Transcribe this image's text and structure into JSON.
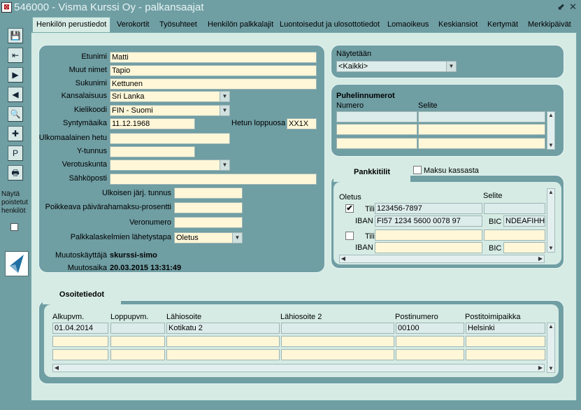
{
  "window": {
    "title": "546000 - Visma Kurssi Oy - palkansaajat",
    "app_icon": "app-icon",
    "minimize": "⬋",
    "close": "✕"
  },
  "toolbar": {
    "buttons": [
      {
        "icon": "save-icon",
        "glyph": "💾"
      },
      {
        "icon": "first-record-icon",
        "glyph": "⇤"
      },
      {
        "icon": "next-record-icon",
        "glyph": "▶"
      },
      {
        "icon": "previous-record-icon",
        "glyph": "◀"
      },
      {
        "icon": "search-icon",
        "glyph": "🔍"
      },
      {
        "icon": "new-record-icon",
        "glyph": "✚"
      },
      {
        "icon": "p-icon",
        "glyph": "P"
      },
      {
        "icon": "print-icon",
        "glyph": "🖶"
      }
    ],
    "show_removed_label": "Näytä poistetut henkilöt"
  },
  "tabs": [
    {
      "label": "Henkilön perustiedot",
      "active": true
    },
    {
      "label": "Verokortit"
    },
    {
      "label": "Työsuhteet"
    },
    {
      "label": "Henkilön palkkalajit"
    },
    {
      "label": "Luontoisedut ja ulosottotiedot"
    },
    {
      "label": "Lomaoikeus"
    },
    {
      "label": "Keskiansiot"
    },
    {
      "label": "Kertymät"
    },
    {
      "label": "Merkkipäivät"
    }
  ],
  "person": {
    "etunimi_label": "Etunimi",
    "etunimi": "Matti",
    "muut_nimet_label": "Muut nimet",
    "muut_nimet": "Tapio",
    "sukunimi_label": "Sukunimi",
    "sukunimi": "Kettunen",
    "kansalaisuus_label": "Kansalaisuus",
    "kansalaisuus": "Sri Lanka",
    "kielikoodi_label": "Kielikoodi",
    "kielikoodi": "FIN - Suomi",
    "syntymaaika_label": "Syntymäaika",
    "syntymaaika": "11.12.1968",
    "hetu_loppuosa_label": "Hetun loppuosa",
    "hetu_loppuosa": "XX1X",
    "ulkomaalainen_hetu_label": "Ulkomaalainen hetu",
    "ulkomaalainen_hetu": "",
    "ytunnus_label": "Y-tunnus",
    "ytunnus": "",
    "verotuskunta_label": "Verotuskunta",
    "verotuskunta": "",
    "sahkoposti_label": "Sähköposti",
    "sahkoposti": "",
    "ulkoisen_label": "Ulkoisen järj. tunnus",
    "ulkoisen": "",
    "poikkeava_label": "Poikkeava päivärahamaksu-prosentti",
    "poikkeava": "",
    "veronumero_label": "Veronumero",
    "veronumero": "",
    "lahetystapa_label": "Palkkalaskelmien lähetystapa",
    "lahetystapa": "Oletus",
    "muutoskayttaja_label": "Muutoskäyttäjä",
    "muutoskayttaja": "skurssi-simo",
    "muutosaika_label": "Muutosaika",
    "muutosaika": "20.03.2015 13:31:49"
  },
  "naytetaan": {
    "label": "Näytetään",
    "value": "<Kaikki>"
  },
  "puhelin": {
    "title": "Puhelinnumerot",
    "col_numero": "Numero",
    "col_selite": "Selite"
  },
  "pankki": {
    "tab_label": "Pankkitilit",
    "maksu_kassasta": "Maksu kassasta",
    "col_oletus": "Oletus",
    "col_selite": "Selite",
    "tili_label": "Tili",
    "iban_label": "IBAN",
    "bic_label": "BIC",
    "row1": {
      "checked": "✔",
      "tili": "123456-7897",
      "iban": "FI57 1234 5600 0078 97",
      "bic": "NDEAFIHH"
    }
  },
  "osoite": {
    "tab_label": "Osoitetiedot",
    "columns": [
      "Alkupvm.",
      "Loppupvm.",
      "Lähiosoite",
      "Lähiosoite 2",
      "Postinumero",
      "Postitoimipaikka"
    ],
    "row1": [
      "01.04.2014",
      "",
      "Kotikatu 2",
      "",
      "00100",
      "Helsinki"
    ]
  }
}
